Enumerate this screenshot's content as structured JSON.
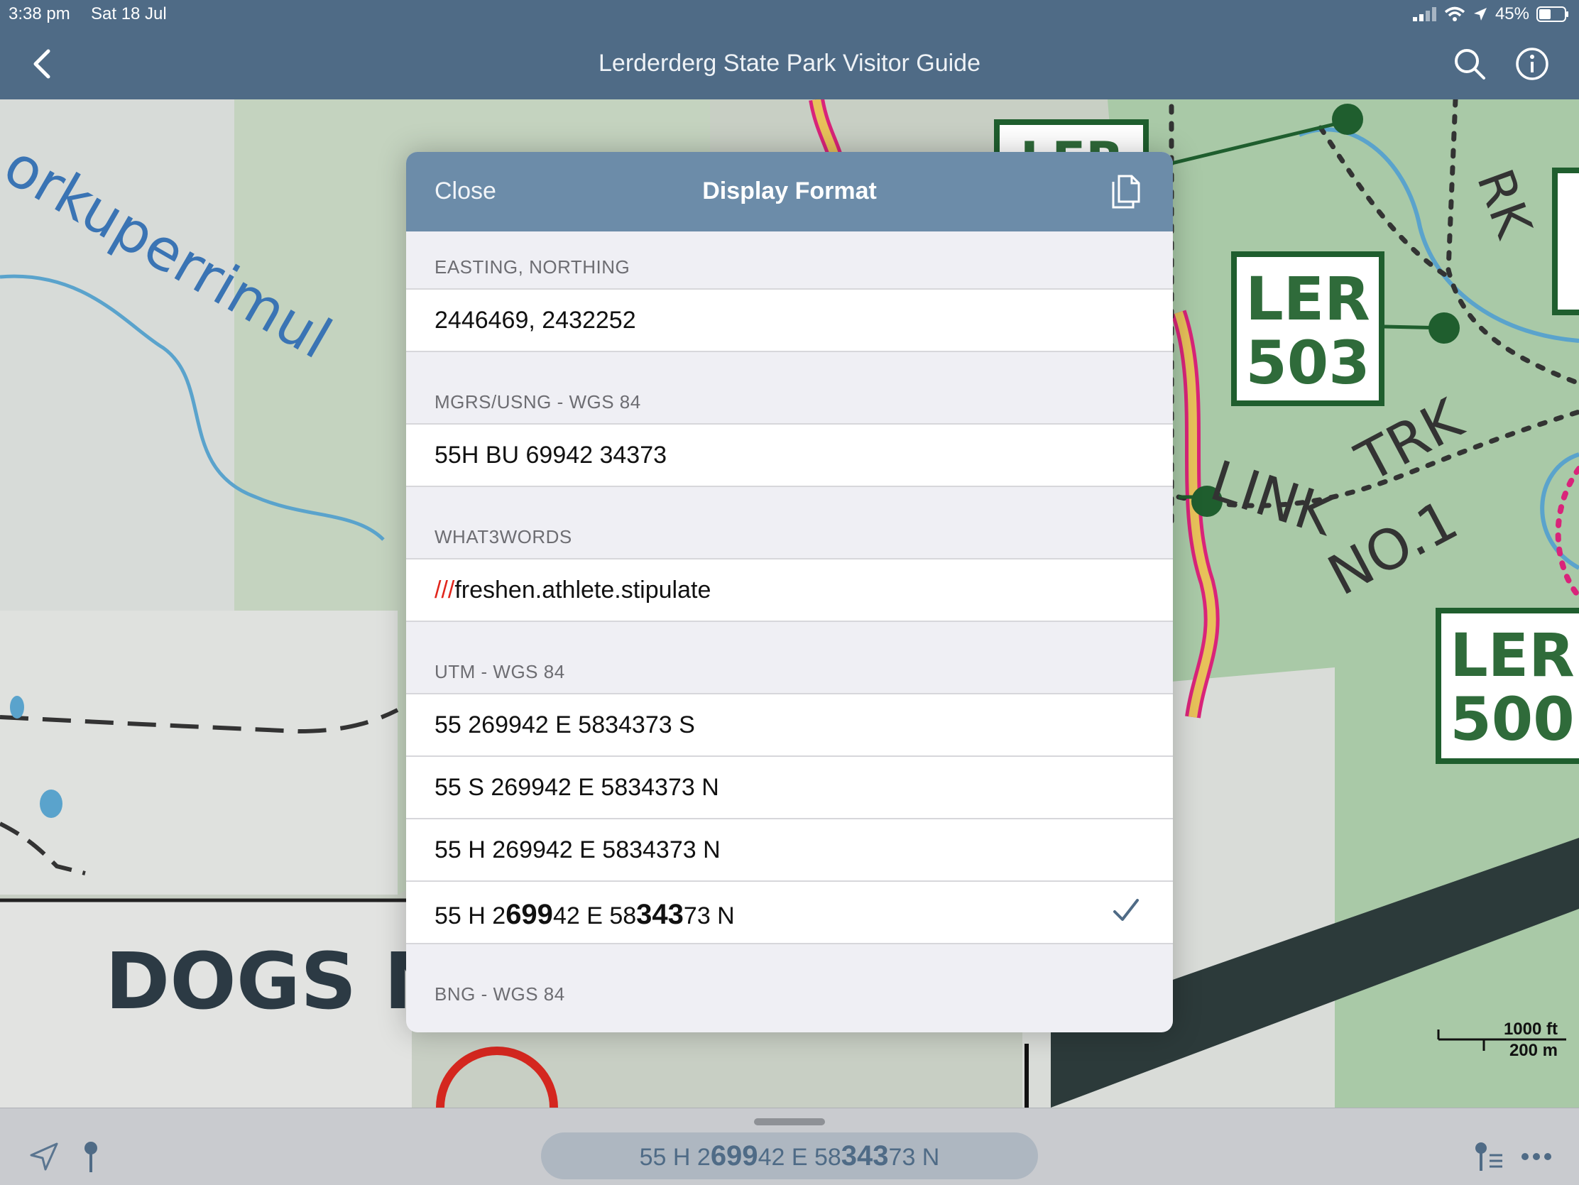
{
  "status_bar": {
    "time": "3:38 pm",
    "date": "Sat 18 Jul",
    "battery": "45%"
  },
  "nav": {
    "title": "Lerderderg State Park Visitor Guide"
  },
  "map": {
    "labels": {
      "creek": "orkuperrimul",
      "marker_503_line1": "LER",
      "marker_503_line2": "503",
      "marker_500_line1": "LER",
      "marker_500_line2": "500",
      "marker_top": "LER",
      "track_1": "LINK",
      "track_2": "TRK",
      "track_3": "NO.1",
      "track_rk": "RK",
      "sign_dogs": "DOGS NO"
    }
  },
  "modal": {
    "close_label": "Close",
    "title": "Display Format",
    "sections": [
      {
        "header": "EASTING, NORTHING",
        "rows": [
          "2446469, 2432252"
        ]
      },
      {
        "header": "MGRS/USNG - WGS 84",
        "rows": [
          "55H BU 69942 34373"
        ]
      },
      {
        "header": "WHAT3WORDS",
        "slashes": "///",
        "words": "freshen.athlete.stipulate"
      },
      {
        "header": "UTM - WGS 84",
        "rows": [
          "55 269942 E 5834373 S",
          "55 S 269942 E 5834373 N",
          "55 H 269942 E 5834373 N"
        ],
        "selected_parts": [
          "55 H 2",
          "699",
          "42 E 58",
          "343",
          "73 N"
        ]
      },
      {
        "header": "BNG - WGS 84"
      }
    ]
  },
  "scale": {
    "feet": "1000 ft",
    "meters": "200 m"
  },
  "bottom_bar": {
    "coord_parts": [
      "55 H 2",
      "699",
      "42 E 58",
      "343",
      "73 N"
    ]
  },
  "colors": {
    "nav_bg": "#4f6b86",
    "modal_header_bg": "#6c8ca9",
    "accent": "#4f6b86",
    "w3w_red": "#e1261c"
  },
  "icons": {
    "back": "chevron-left-icon",
    "search": "search-icon",
    "info": "info-icon",
    "copy": "copy-icon",
    "check": "checkmark-icon",
    "location": "location-arrow-icon",
    "pin": "pin-icon",
    "pin_list": "pin-list-icon",
    "more": "more-icon"
  }
}
